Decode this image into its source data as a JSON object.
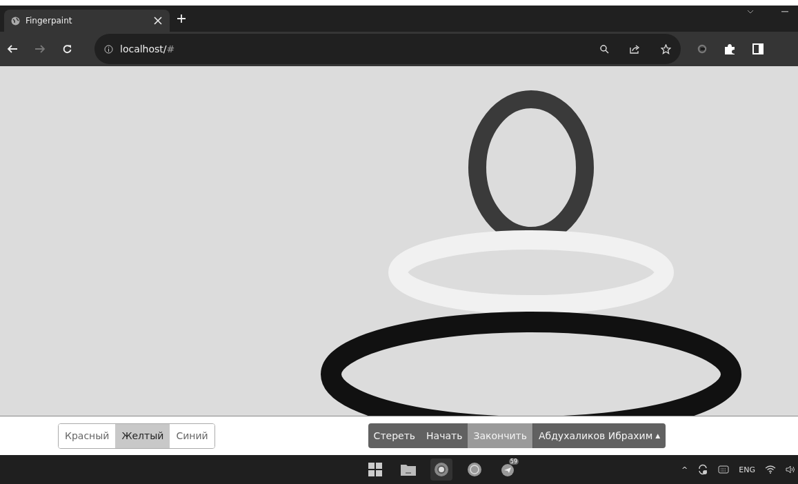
{
  "browser": {
    "tab": {
      "title": "Fingerpaint"
    },
    "address": {
      "host": "localhost/",
      "hash": "#"
    },
    "forward_disabled": true
  },
  "color_buttons": [
    {
      "label": "Красный",
      "selected": false
    },
    {
      "label": "Желтый",
      "selected": true
    },
    {
      "label": "Синий",
      "selected": false
    }
  ],
  "action_buttons": [
    {
      "label": "Стереть",
      "selected": false
    },
    {
      "label": "Начать",
      "selected": false
    },
    {
      "label": "Закончить",
      "selected": true
    }
  ],
  "user_menu": {
    "label": "Абдухаликов Ибрахим",
    "caret": "▲"
  },
  "taskbar": {
    "telegram_badge": "59",
    "language": "ENG",
    "chevron": "^"
  }
}
